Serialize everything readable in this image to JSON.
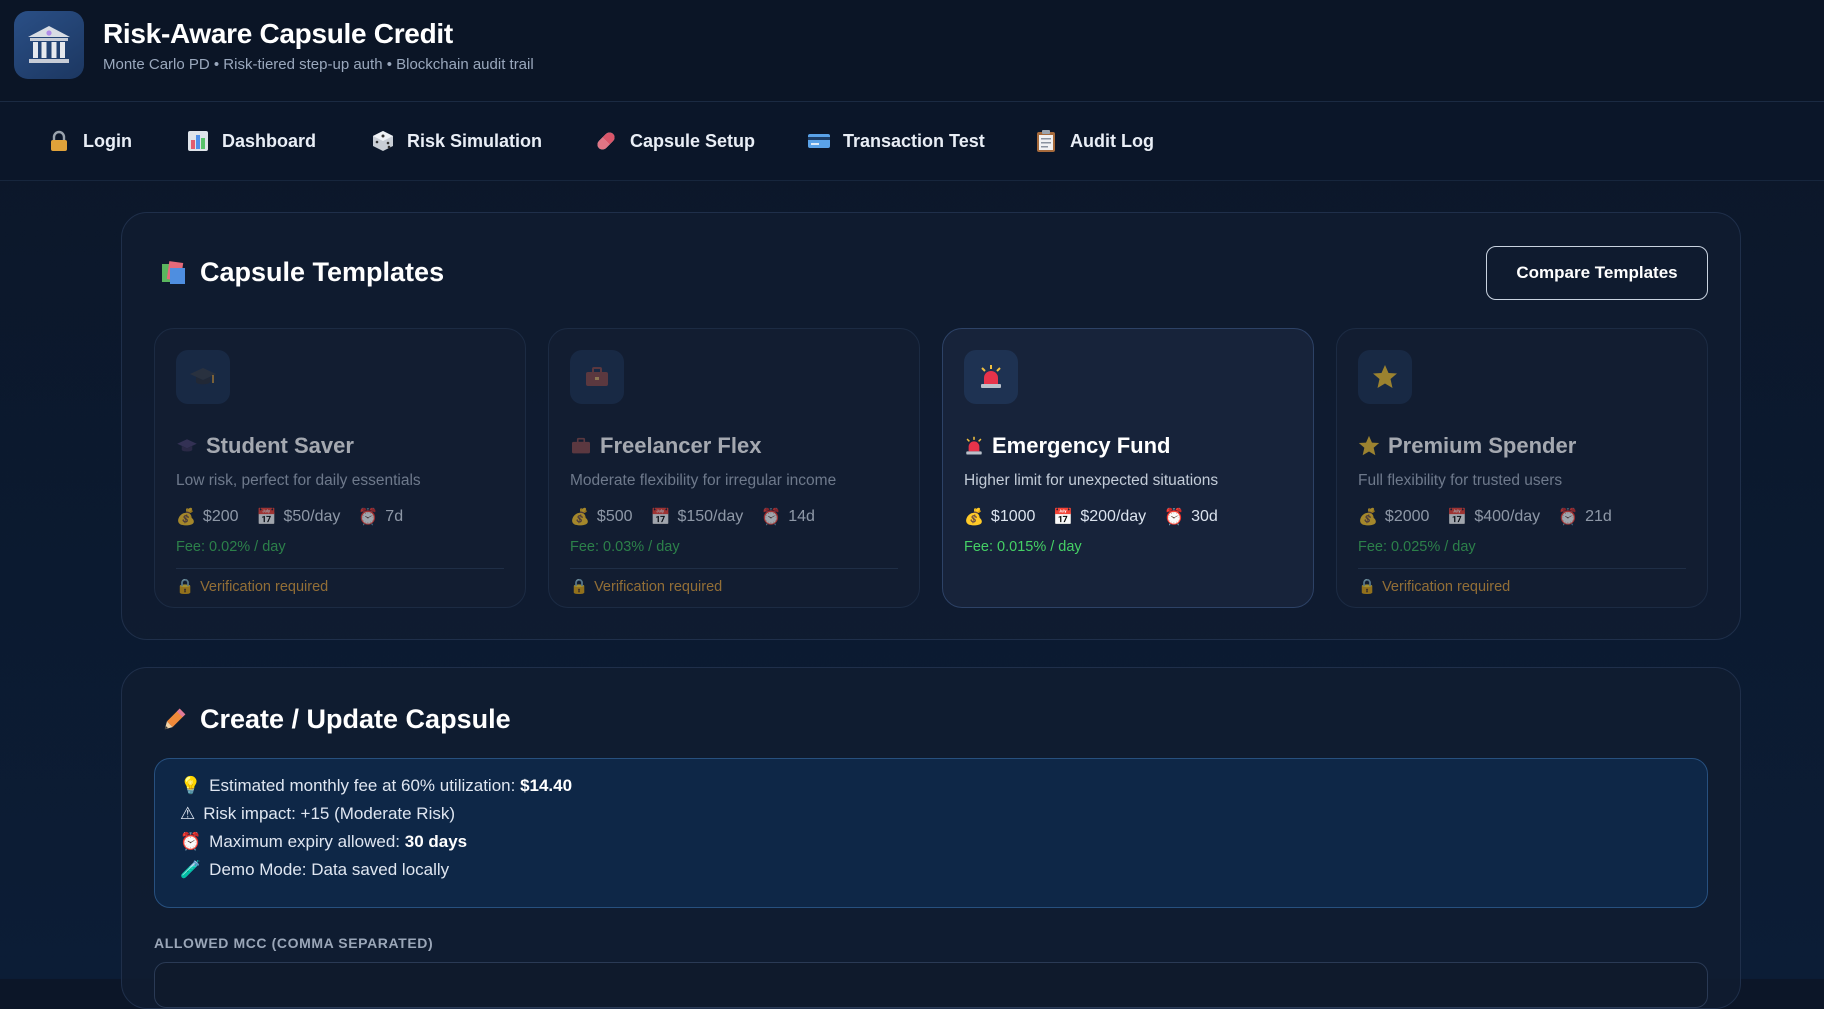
{
  "header": {
    "title": "Risk-Aware Capsule Credit",
    "subtitle": "Monte Carlo PD • Risk-tiered step-up auth • Blockchain audit trail",
    "logo_icon": "bank-icon"
  },
  "nav": [
    {
      "label": "Login",
      "icon": "lock-icon"
    },
    {
      "label": "Dashboard",
      "icon": "bar-chart-icon"
    },
    {
      "label": "Risk Simulation",
      "icon": "dice-icon"
    },
    {
      "label": "Capsule Setup",
      "icon": "pill-icon"
    },
    {
      "label": "Transaction Test",
      "icon": "credit-card-icon"
    },
    {
      "label": "Audit Log",
      "icon": "clipboard-icon"
    }
  ],
  "templates": {
    "title": "Capsule Templates",
    "title_icon": "books-icon",
    "compare_label": "Compare Templates",
    "cards": [
      {
        "name": "Student Saver",
        "icon": "graduation-cap-icon",
        "desc": "Low risk, perfect for daily essentials",
        "amount": "$200",
        "daily": "$50/day",
        "expiry": "7d",
        "fee": "Fee: 0.02% / day",
        "verify": "Verification required"
      },
      {
        "name": "Freelancer Flex",
        "icon": "briefcase-icon",
        "desc": "Moderate flexibility for irregular income",
        "amount": "$500",
        "daily": "$150/day",
        "expiry": "14d",
        "fee": "Fee: 0.03% / day",
        "verify": "Verification required"
      },
      {
        "name": "Emergency Fund",
        "icon": "siren-icon",
        "desc": "Higher limit for unexpected situations",
        "amount": "$1000",
        "daily": "$200/day",
        "expiry": "30d",
        "fee": "Fee: 0.015% / day",
        "verify": ""
      },
      {
        "name": "Premium Spender",
        "icon": "star-icon",
        "desc": "Full flexibility for trusted users",
        "amount": "$2000",
        "daily": "$400/day",
        "expiry": "21d",
        "fee": "Fee: 0.025% / day",
        "verify": "Verification required"
      }
    ]
  },
  "create": {
    "title": "Create / Update Capsule",
    "title_icon": "pencil-icon",
    "info": {
      "fee_prefix": "Estimated monthly fee at 60% utilization: ",
      "fee_value": "$14.40",
      "risk": "Risk impact: +15 (Moderate Risk)",
      "expiry_prefix": "Maximum expiry allowed: ",
      "expiry_value": "30 days",
      "demo": "Demo Mode: Data saved locally"
    },
    "mcc_label": "ALLOWED MCC (COMMA SEPARATED)",
    "mcc_value": ""
  },
  "colors": {
    "background": "#0c1628",
    "accent_green": "#3fbf5a",
    "warning_orange": "#e3a13a",
    "info_bg": "#0e2747"
  }
}
